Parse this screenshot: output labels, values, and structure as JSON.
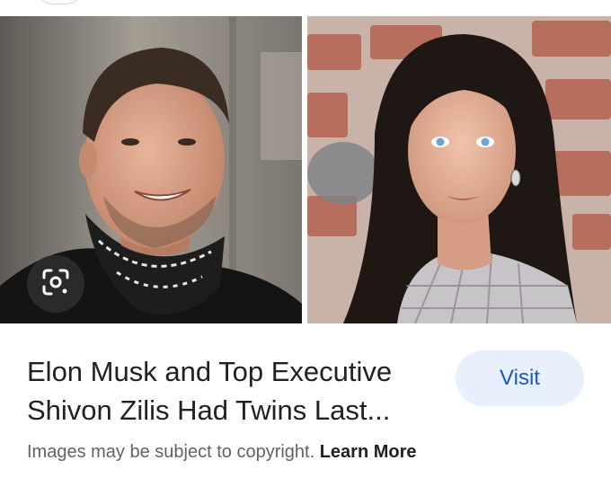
{
  "result": {
    "title": "Elon Musk and Top Executive Shivon Zilis Had Twins Last...",
    "visit_label": "Visit",
    "copyright_text": "Images may be subject to copyright.",
    "learn_more_label": "Learn More"
  },
  "icons": {
    "lens": "google-lens-icon"
  },
  "colors": {
    "visit_bg": "#e8f0fe",
    "visit_text": "#1a56c4",
    "title_text": "#202124",
    "copyright_text": "#5f6368"
  }
}
